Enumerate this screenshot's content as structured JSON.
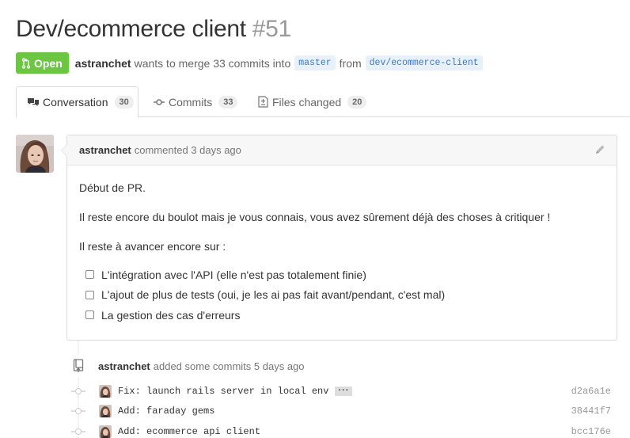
{
  "pr": {
    "title": "Dev/ecommerce client",
    "number": "#51",
    "state": "Open",
    "author": "astranchet",
    "merge_text": "wants to merge 33 commits into",
    "base_branch": "master",
    "from_text": "from",
    "head_branch": "dev/ecommerce-client"
  },
  "tabs": [
    {
      "label": "Conversation",
      "count": "30",
      "icon": "comment-discussion-icon"
    },
    {
      "label": "Commits",
      "count": "33",
      "icon": "git-commit-icon"
    },
    {
      "label": "Files changed",
      "count": "20",
      "icon": "diff-icon"
    }
  ],
  "comment": {
    "author": "astranchet",
    "meta": "commented 3 days ago",
    "paragraphs": [
      "Début de PR.",
      "Il reste encore du boulot mais je vous connais, vous avez sûrement déjà des choses à critiquer !",
      "Il reste à avancer encore sur :"
    ],
    "tasks": [
      "L'intégration avec l'API (elle n'est pas totalement finie)",
      "L'ajout de plus de tests (oui, je les ai pas fait avant/pendant, c'est mal)",
      "La gestion des cas d'erreurs"
    ]
  },
  "push": {
    "author": "astranchet",
    "text": "added some commits 5 days ago"
  },
  "commits": [
    {
      "message": "Fix: launch rails server in local env",
      "sha": "d2a6a1e",
      "has_ellipsis": true
    },
    {
      "message": "Add: faraday gems",
      "sha": "38441f7"
    },
    {
      "message": "Add: ecommerce api client",
      "sha": "bcc176e"
    }
  ],
  "colors": {
    "open_state": "#6cc644",
    "branch_bg": "#e8f1fa",
    "branch_text": "#4078c0"
  }
}
